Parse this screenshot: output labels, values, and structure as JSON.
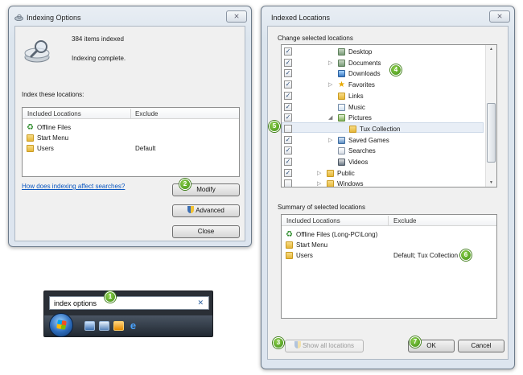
{
  "indexing_window": {
    "title": "Indexing Options",
    "items_indexed": "384 items indexed",
    "status": "Indexing complete.",
    "index_these_locations": "Index these locations:",
    "columns": [
      "Included Locations",
      "Exclude"
    ],
    "rows": [
      {
        "location": "Offline Files",
        "exclude": "",
        "icon": "offline-files-icon"
      },
      {
        "location": "Start Menu",
        "exclude": "",
        "icon": "folder-icon"
      },
      {
        "location": "Users",
        "exclude": "Default",
        "icon": "folder-icon"
      }
    ],
    "help_link": "How does indexing affect searches?",
    "buttons": {
      "modify": "Modify",
      "advanced": "Advanced",
      "close": "Close"
    },
    "close_glyph": "⨯"
  },
  "indexed_locations_window": {
    "title": "Indexed Locations",
    "change_label": "Change selected locations",
    "tree": [
      {
        "label": "Desktop",
        "checked": true,
        "icon": "desktop-folder-icon"
      },
      {
        "label": "Documents",
        "checked": true,
        "icon": "library-icon",
        "expander": "▷"
      },
      {
        "label": "Downloads",
        "checked": true,
        "icon": "downloads-icon"
      },
      {
        "label": "Favorites",
        "checked": true,
        "icon": "favorites-star-icon",
        "expander": "▷"
      },
      {
        "label": "Links",
        "checked": true,
        "icon": "links-icon"
      },
      {
        "label": "Music",
        "checked": true,
        "icon": "music-icon"
      },
      {
        "label": "Pictures",
        "checked": true,
        "icon": "pictures-icon",
        "expander": "◢"
      },
      {
        "label": "Tux Collection",
        "checked": false,
        "icon": "folder-icon"
      },
      {
        "label": "Saved Games",
        "checked": true,
        "icon": "saved-games-icon",
        "expander": "▷"
      },
      {
        "label": "Searches",
        "checked": true,
        "icon": "searches-icon"
      },
      {
        "label": "Videos",
        "checked": true,
        "icon": "videos-icon"
      },
      {
        "label": "Public",
        "checked": true,
        "icon": "folder-icon",
        "expander": "▷"
      },
      {
        "label": "Windows",
        "checked": false,
        "icon": "folder-icon",
        "expander": "▷"
      }
    ],
    "summary_label": "Summary of selected locations",
    "columns": [
      "Included Locations",
      "Exclude"
    ],
    "summary_rows": [
      {
        "location": "Offline Files (Long-PC\\Long)",
        "exclude": "",
        "icon": "offline-files-icon"
      },
      {
        "location": "Start Menu",
        "exclude": "",
        "icon": "folder-icon"
      },
      {
        "location": "Users",
        "exclude": "Default; Tux Collection",
        "icon": "folder-icon"
      }
    ],
    "buttons": {
      "show_all": "Show all locations",
      "ok": "OK",
      "cancel": "Cancel"
    },
    "close_glyph": "⨯"
  },
  "taskbar": {
    "search_value": "index options",
    "clear_glyph": "✕"
  },
  "badges": [
    "1",
    "2",
    "3",
    "4",
    "5",
    "6",
    "7"
  ],
  "colors": {
    "badge_green": "#4aa01b",
    "link_blue": "#0b57c0"
  }
}
